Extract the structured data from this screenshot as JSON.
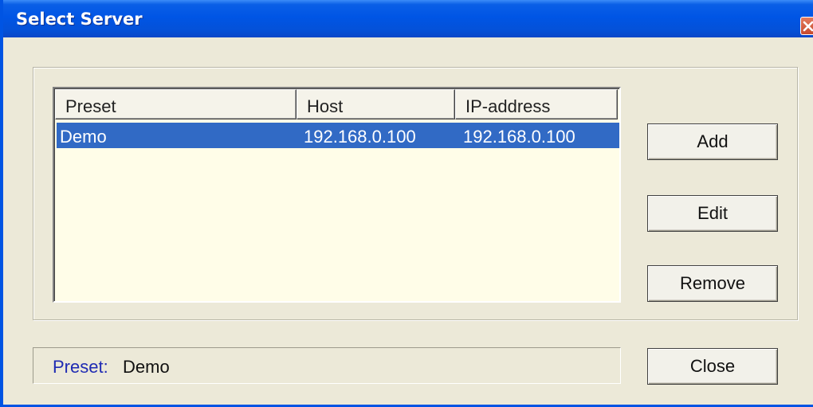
{
  "window": {
    "title": "Select Server"
  },
  "table": {
    "columns": [
      "Preset",
      "Host",
      "IP-address"
    ],
    "rows": [
      {
        "preset": "Demo",
        "host": "192.168.0.100",
        "ip": "192.168.0.100",
        "selected": true
      }
    ]
  },
  "buttons": {
    "add": "Add",
    "edit": "Edit",
    "remove": "Remove",
    "close": "Close"
  },
  "status": {
    "label": "Preset:",
    "value": "Demo"
  },
  "colors": {
    "title_bar": "#0055e5",
    "selection": "#316ac5",
    "list_background": "#fffde8",
    "status_label": "#1f2bb3"
  },
  "icons": {
    "close": "close-icon"
  }
}
